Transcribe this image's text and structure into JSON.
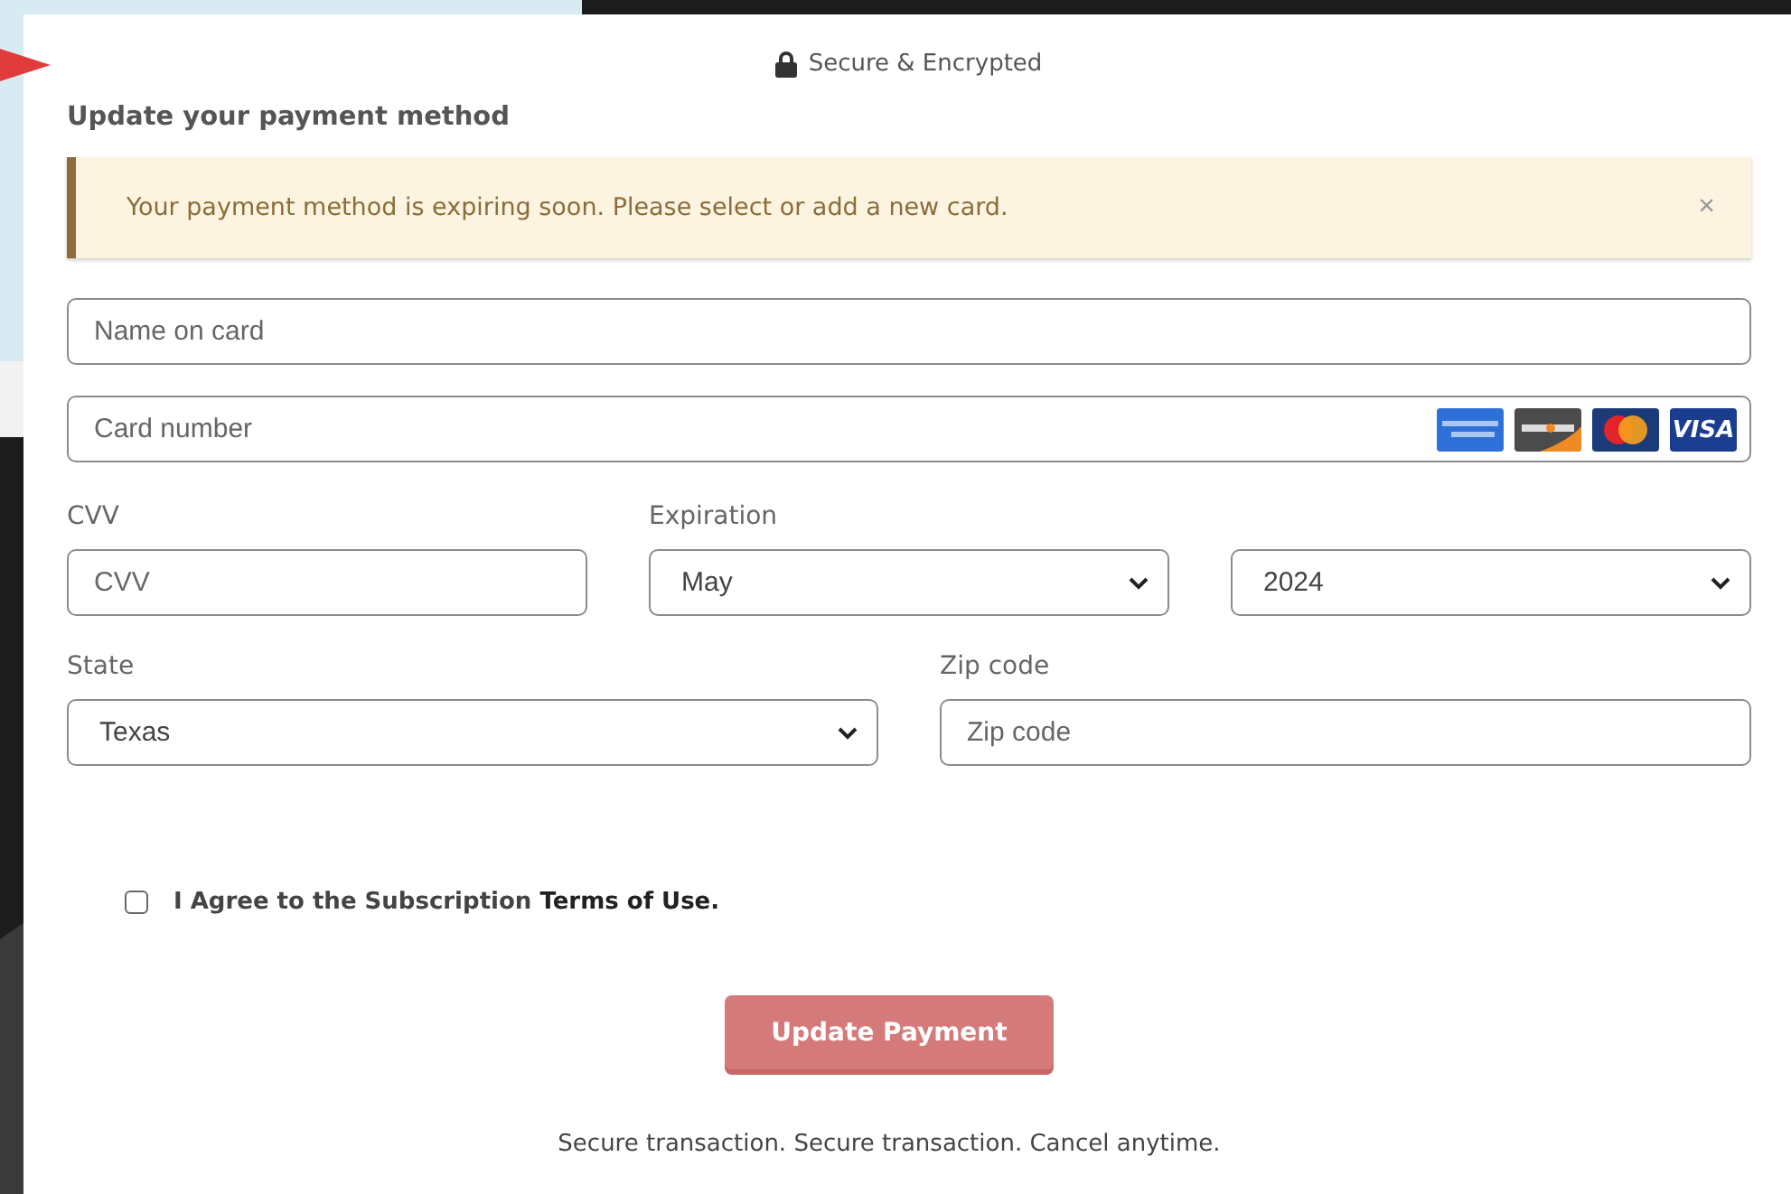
{
  "header": {
    "secure_label": "Secure & Encrypted"
  },
  "title": "Update your payment method",
  "alert": {
    "message": "Your payment method is expiring soon. Please select or add a new card.",
    "close": "×"
  },
  "name_field": {
    "placeholder": "Name on card"
  },
  "card_field": {
    "placeholder": "Card number",
    "brands": [
      {
        "kind": "amex"
      },
      {
        "kind": "discover"
      },
      {
        "kind": "mastercard"
      },
      {
        "kind": "visa",
        "label": "VISA"
      }
    ]
  },
  "cvv": {
    "label": "CVV",
    "placeholder": "CVV"
  },
  "expiration": {
    "label": "Expiration",
    "month": "May",
    "year": "2024"
  },
  "state": {
    "label": "State",
    "value": "Texas"
  },
  "zip": {
    "label": "Zip code",
    "placeholder": "Zip code"
  },
  "agreement": {
    "text": "I Agree to the Subscription",
    "link": "Terms of Use.",
    "checked": false
  },
  "submit": {
    "label": "Update Payment",
    "disabled": true
  },
  "footer": "Secure transaction. Secure transaction. Cancel anytime."
}
